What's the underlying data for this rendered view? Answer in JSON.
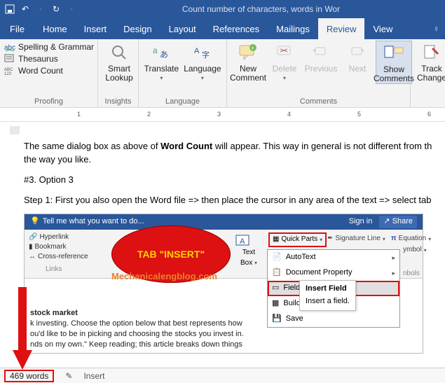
{
  "titlebar": {
    "title": "Count number of characters, words in Wor"
  },
  "menu": {
    "file": "File",
    "tabs": [
      "Home",
      "Insert",
      "Design",
      "Layout",
      "References",
      "Mailings",
      "Review",
      "View"
    ],
    "active": "Review",
    "tellme_glyph": "ⓘ"
  },
  "ribbon": {
    "proofing": {
      "spelling": "Spelling & Grammar",
      "thesaurus": "Thesaurus",
      "wordcount": "Word Count",
      "label": "Proofing"
    },
    "insights": {
      "smart_l1": "Smart",
      "smart_l2": "Lookup",
      "label": "Insights"
    },
    "language": {
      "translate": "Translate",
      "language": "Language",
      "label": "Language"
    },
    "comments": {
      "new_l1": "New",
      "new_l2": "Comment",
      "delete": "Delete",
      "previous": "Previous",
      "next": "Next",
      "show_l1": "Show",
      "show_l2": "Comments",
      "label": "Comments"
    },
    "tracking": {
      "track_l1": "Track",
      "track_l2": "Change"
    }
  },
  "ruler": {
    "marks": [
      "1",
      "2",
      "3",
      "4",
      "5",
      "6"
    ]
  },
  "doc": {
    "p1a": "The same dialog box as above of ",
    "p1b": "Word Count",
    "p1c": " will appear. This way in general is not different from th",
    "p1d": "the way you like.",
    "p2": "#3. Option 3",
    "p3": "Step 1: First you also open the Word file => then place the cursor in any area of the text => select tab"
  },
  "inner": {
    "tellme": "Tell me what you want to do...",
    "signin": "Sign in",
    "share": "Share",
    "links": [
      "Hyperlink",
      "Bookmark",
      "Cross-reference"
    ],
    "links_label": "Links",
    "text_l1": "Text",
    "text_l2": "Box",
    "quickparts": "Quick Parts",
    "sigline": "Signature Line",
    "equation": "Equation",
    "symbol": "ymbol",
    "symbols_lbl": "nbols",
    "dd": {
      "autotext": "AutoText",
      "docprop": "Document Property",
      "field": "Field...",
      "build": "Buildi",
      "save": "Save"
    },
    "tooltip": {
      "title": "Insert Field",
      "body": "Insert a field."
    },
    "tab_label": "TAB \"INSERT\"",
    "mech": "Mechanicalengblog.com",
    "docbody": {
      "l1": "stock market",
      "l2": "k investing. Choose the option below that best represents how",
      "l3": "ou'd like to be in picking and choosing the stocks you invest in.",
      "l4": "nds on my own.\" Keep reading; this article breaks down things"
    }
  },
  "status": {
    "words": "469 words",
    "proofing_icon": "✎",
    "insert": "Insert"
  },
  "colors": {
    "accent": "#2a579a",
    "highlight": "#d11",
    "tab_text": "#ffd400"
  }
}
